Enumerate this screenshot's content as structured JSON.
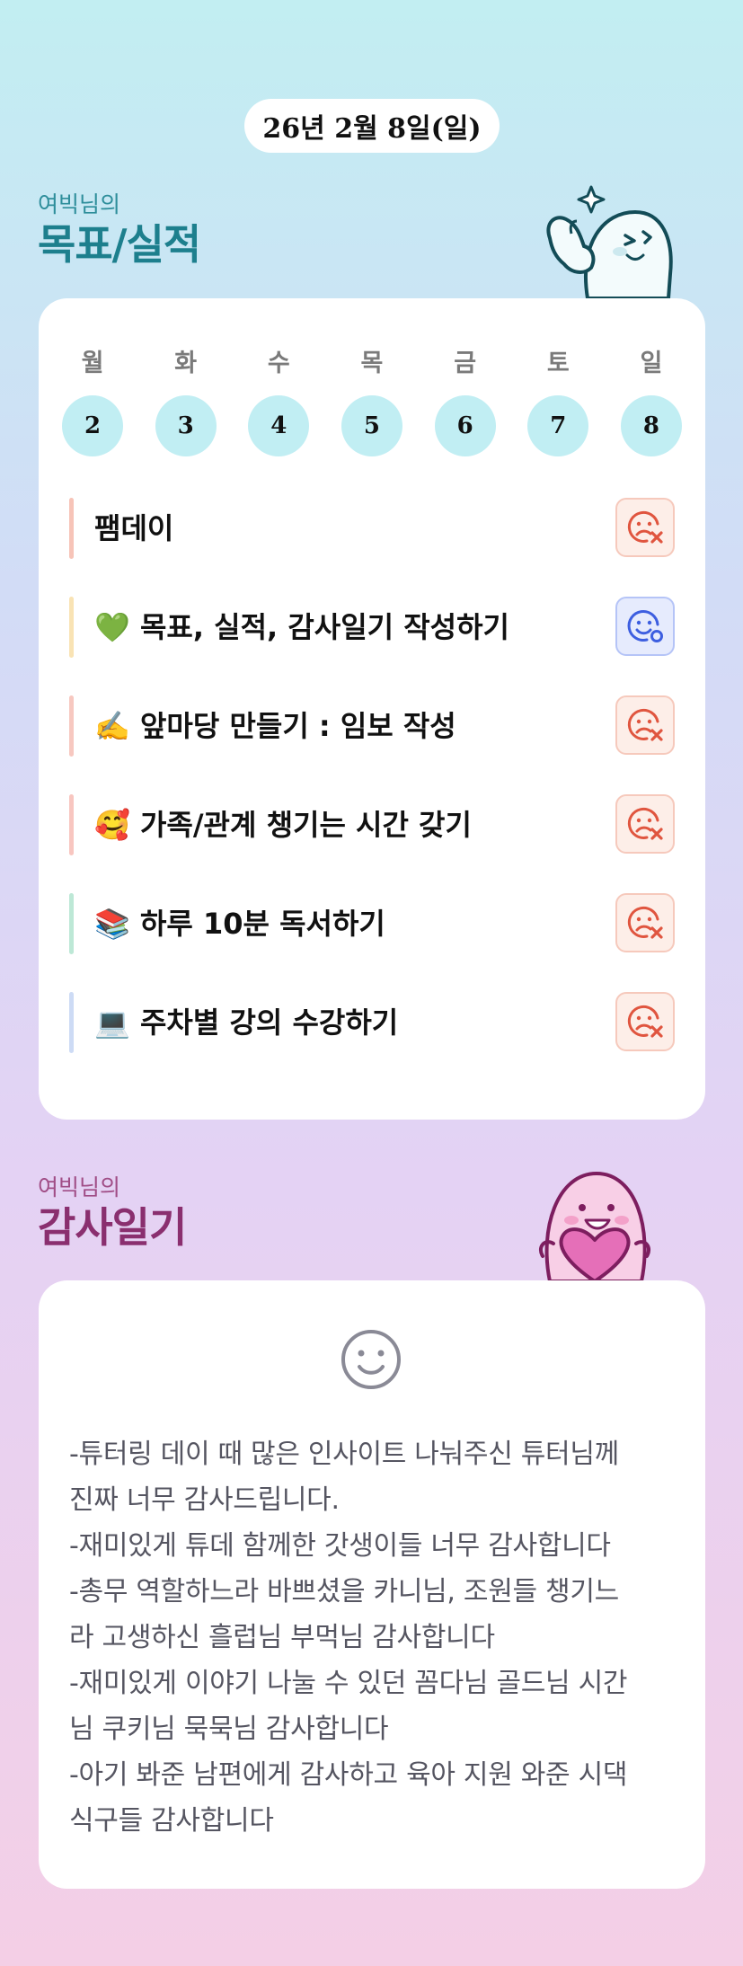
{
  "date": "26년 2월 8일(일)",
  "goals_section": {
    "owner": "여빅님의",
    "title": "목표/실적"
  },
  "week": {
    "labels": [
      "월",
      "화",
      "수",
      "목",
      "금",
      "토",
      "일"
    ],
    "dates": [
      "2",
      "3",
      "4",
      "5",
      "6",
      "7",
      "8"
    ]
  },
  "goals": [
    {
      "text": "팸데이",
      "bar_color": "#f7c4b8",
      "status": "not-done",
      "status_icon": "sad-face-x-icon"
    },
    {
      "text": "💚 목표, 실적, 감사일기 작성하기",
      "bar_color": "#f9e3b4",
      "status": "done",
      "status_icon": "smile-face-check-icon"
    },
    {
      "text": "✍️ 앞마당 만들기 : 임보 작성",
      "bar_color": "#f7c8c0",
      "status": "not-done",
      "status_icon": "sad-face-x-icon"
    },
    {
      "text": "🥰 가족/관계 챙기는 시간 갖기",
      "bar_color": "#f8c6c0",
      "status": "not-done",
      "status_icon": "sad-face-x-icon"
    },
    {
      "text": "📚 하루 10분 독서하기",
      "bar_color": "#bde8d6",
      "status": "not-done",
      "status_icon": "sad-face-x-icon"
    },
    {
      "text": "💻 주차별 강의 수강하기",
      "bar_color": "#cddbf5",
      "status": "not-done",
      "status_icon": "sad-face-x-icon"
    }
  ],
  "gratitude_section": {
    "owner": "여빅님의",
    "title": "감사일기"
  },
  "gratitude": {
    "mood_icon": "smile-face-icon",
    "text": "-튜터링 데이 때 많은 인사이트 나눠주신 튜터님께\n진짜 너무 감사드립니다.\n-재미있게 튜데 함께한 갓생이들 너무 감사합니다\n-총무 역할하느라 바쁘셨을 카니님, 조원들 챙기느\n라 고생하신 흘럽님 부먹님 감사합니다\n-재미있게 이야기 나눌 수 있던 꼼다님 골드님 시간\n님 쿠키님 묵묵님 감사합니다\n-아기 봐준 남편에게 감사하고 육아 지원 와준 시댁\n식구들 감사합니다"
  }
}
